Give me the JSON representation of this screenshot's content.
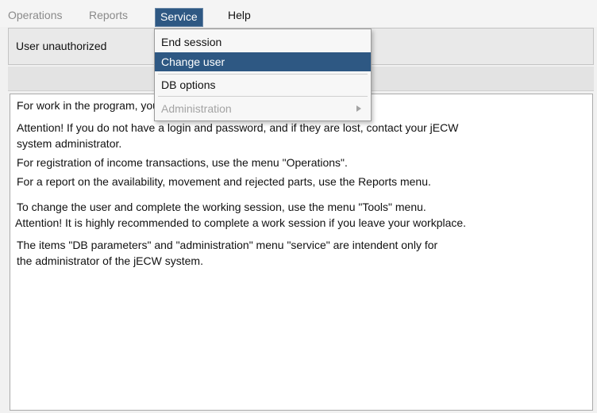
{
  "menubar": {
    "operations": "Operations",
    "reports": "Reports",
    "service": "Service",
    "help": "Help"
  },
  "header": {
    "status": "User unauthorized"
  },
  "service_menu": {
    "items": [
      {
        "label": "End session",
        "state": "normal"
      },
      {
        "label": "Change user",
        "state": "selected"
      },
      {
        "label": "DB options",
        "state": "normal"
      },
      {
        "label": "Administration",
        "state": "disabled",
        "has_submenu": true
      }
    ]
  },
  "content": {
    "lines": [
      "For work in the program, you need to pass authorization",
      "Attention! If you do not have a login and password, and if they are lost, contact your jECW",
      "system administrator.",
      "For registration of income transactions, use the menu \"Operations\".",
      "For a report on the availability, movement and rejected parts, use the Reports menu.",
      "To change the user and complete the working session, use the menu \"Tools\" menu.",
      "Attention! It is highly recommended to complete a work session if you leave your workplace.",
      "The items \"DB parameters\" and \"administration\" menu \"service\" are intendent only for",
      "the administrator of the jECW system."
    ]
  },
  "colors": {
    "selection": "#2e5883",
    "disabled_text": "#a3a3a3"
  }
}
